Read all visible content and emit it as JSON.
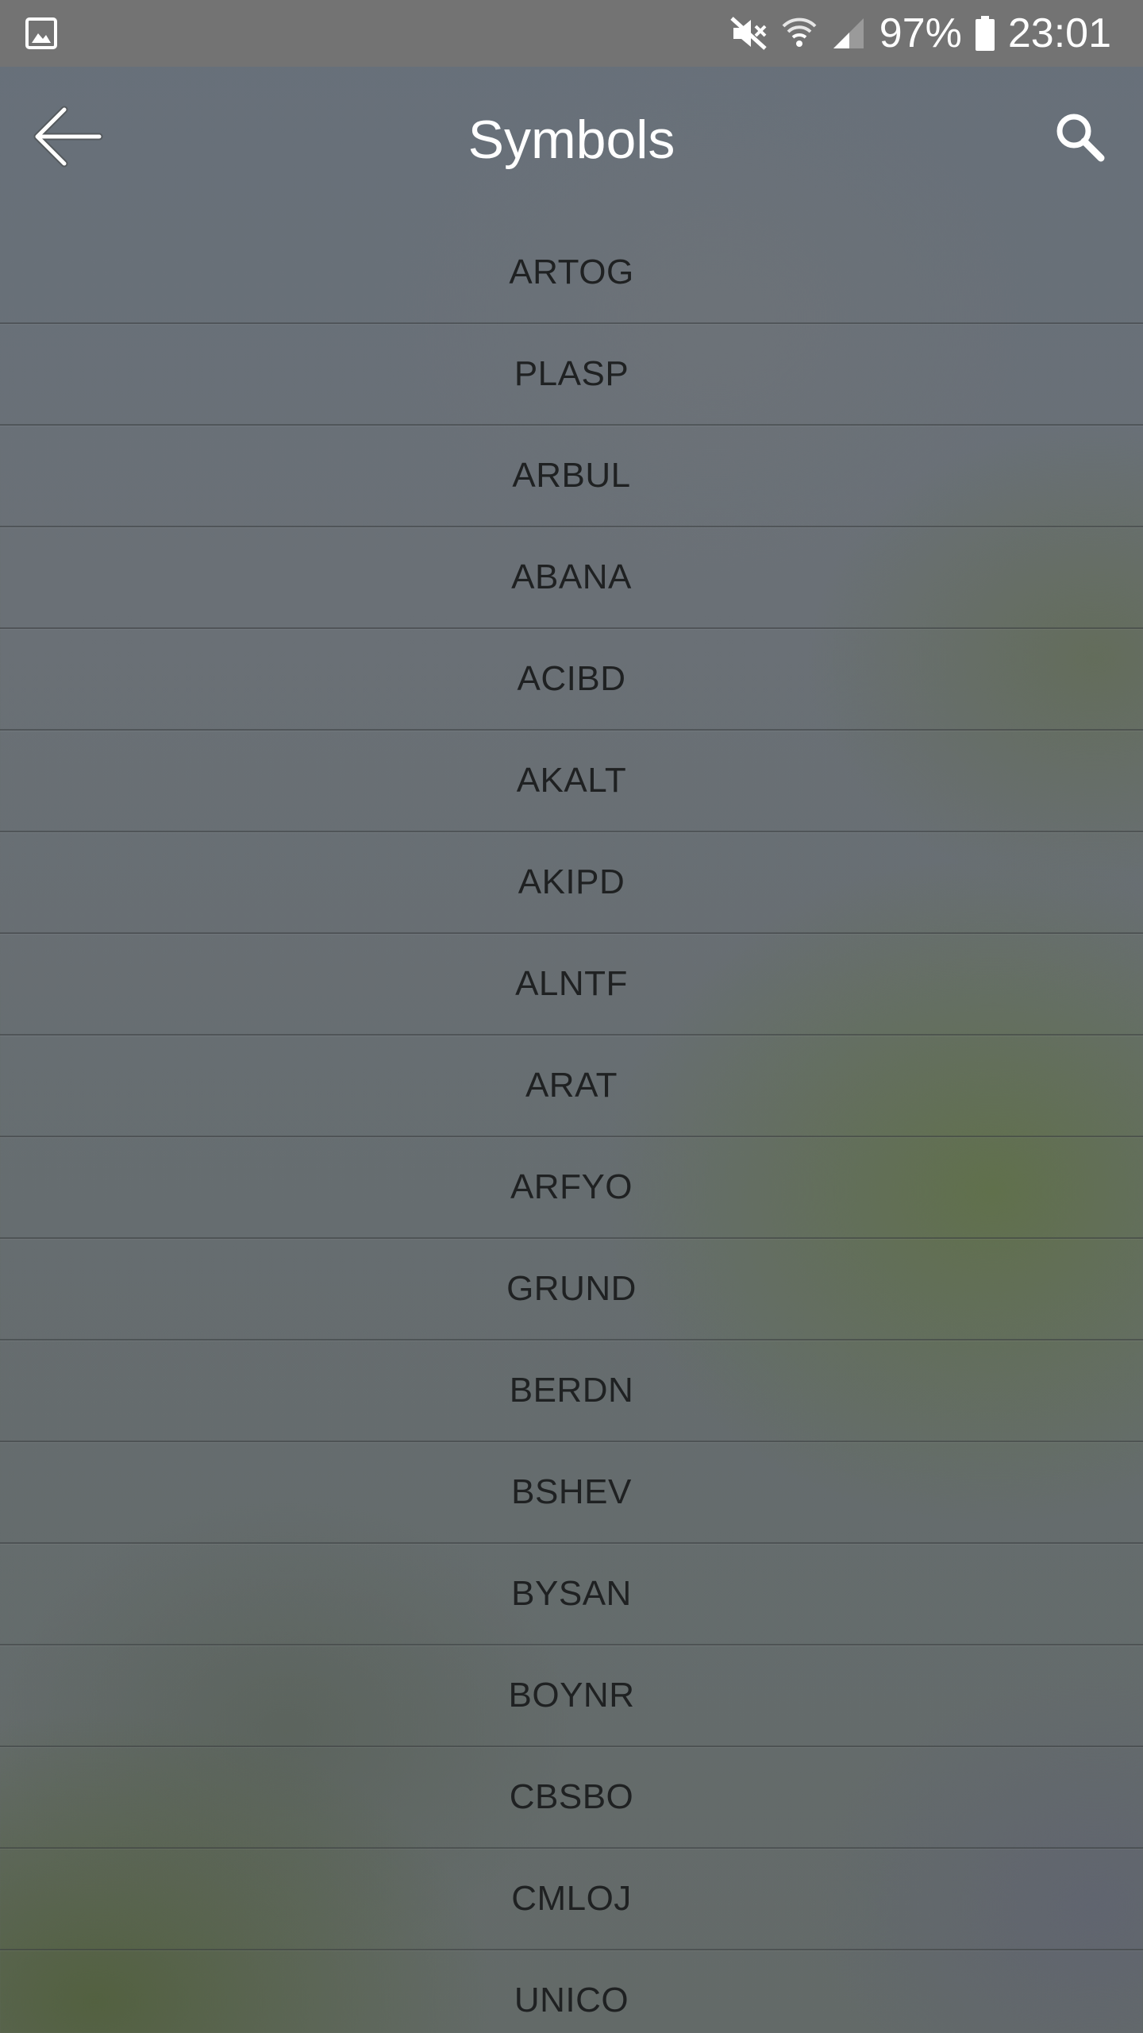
{
  "status_bar": {
    "battery": "97%",
    "time": "23:01",
    "icons": [
      "gallery-notification-icon",
      "mute-icon",
      "wifi-icon",
      "signal-icon",
      "battery-icon"
    ]
  },
  "app_bar": {
    "title": "Symbols",
    "back_icon": "arrow-back-icon",
    "search_icon": "search-icon"
  },
  "symbols": [
    {
      "label": "ARTOG"
    },
    {
      "label": "PLASP"
    },
    {
      "label": "ARBUL"
    },
    {
      "label": "ABANA"
    },
    {
      "label": "ACIBD"
    },
    {
      "label": "AKALT"
    },
    {
      "label": "AKIPD"
    },
    {
      "label": "ALNTF"
    },
    {
      "label": "ARAT"
    },
    {
      "label": "ARFYO"
    },
    {
      "label": "GRUND"
    },
    {
      "label": "BERDN"
    },
    {
      "label": "BSHEV"
    },
    {
      "label": "BYSAN"
    },
    {
      "label": "BOYNR"
    },
    {
      "label": "CBSBO"
    },
    {
      "label": "CMLOJ"
    },
    {
      "label": "UNICO"
    }
  ]
}
